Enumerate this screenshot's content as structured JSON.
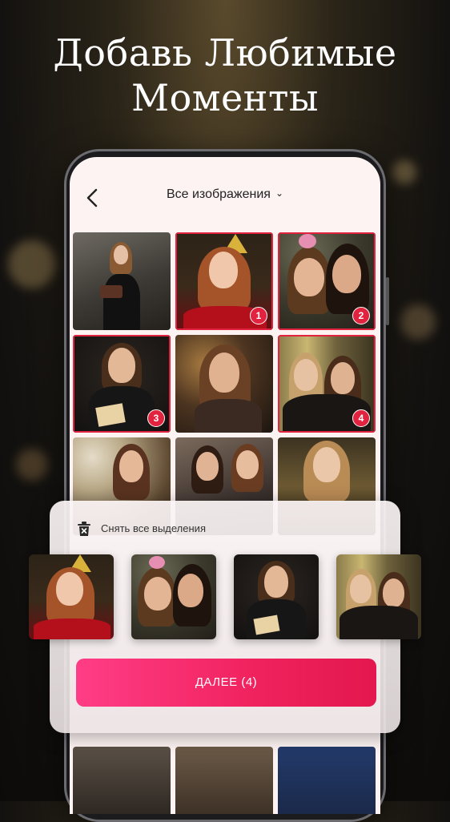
{
  "headline": {
    "line1": "Добавь Любимые",
    "line2": "Моменты"
  },
  "header": {
    "back_icon": "chevron-left-icon",
    "album_label": "Все изображения",
    "dropdown_icon": "chevron-down-icon"
  },
  "grid": {
    "items": [
      {
        "id": "photo-1",
        "selected": false,
        "badge": ""
      },
      {
        "id": "photo-2",
        "selected": true,
        "badge": "1"
      },
      {
        "id": "photo-3",
        "selected": true,
        "badge": "2"
      },
      {
        "id": "photo-4",
        "selected": true,
        "badge": "3"
      },
      {
        "id": "photo-5",
        "selected": false,
        "badge": ""
      },
      {
        "id": "photo-6",
        "selected": true,
        "badge": "4"
      },
      {
        "id": "photo-7",
        "selected": false,
        "badge": ""
      },
      {
        "id": "photo-8",
        "selected": false,
        "badge": ""
      },
      {
        "id": "photo-9",
        "selected": false,
        "badge": ""
      }
    ]
  },
  "selection_panel": {
    "clear_icon": "trash-x-icon",
    "clear_label": "Снять все выделения",
    "next_label": "ДАЛЕЕ (4)"
  },
  "colors": {
    "accent": "#e2233f",
    "button_start": "#ff3d86",
    "button_end": "#e3184e"
  }
}
